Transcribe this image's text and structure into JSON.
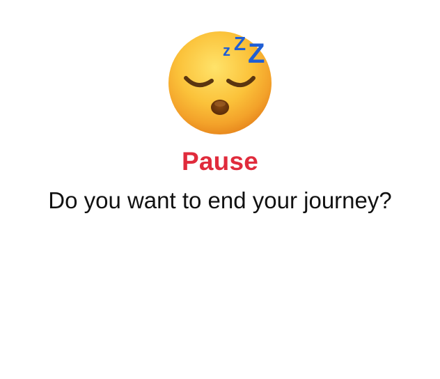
{
  "dialog": {
    "icon": "sleeping-face-icon",
    "title": "Pause",
    "message": "Do you want to end your journey?"
  },
  "colors": {
    "title": "#e02b3c",
    "message": "#111111",
    "background": "#ffffff",
    "emoji_face": "#f7b928",
    "zzz": "#1f5ed4"
  }
}
